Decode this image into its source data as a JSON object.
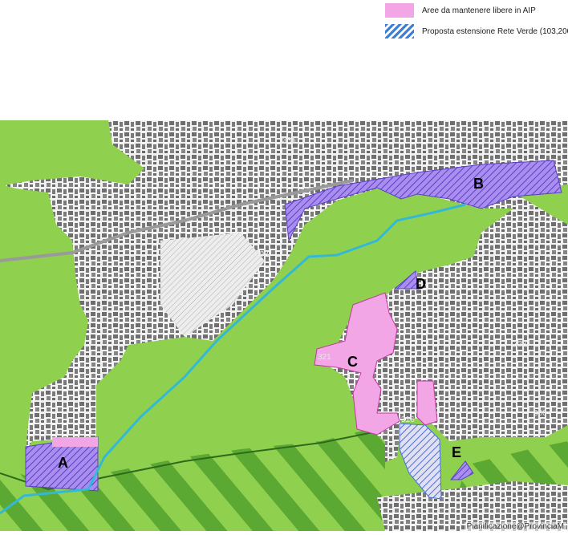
{
  "legend": {
    "items": [
      {
        "label": "Aree da mantenere libere in AIP",
        "swatch": "pink-fill"
      },
      {
        "label": "Proposta estensione Rete Verde (103,200",
        "swatch": "blue-hatch"
      }
    ]
  },
  "map": {
    "labels": [
      "A",
      "B",
      "C",
      "D",
      "E"
    ],
    "elevations": [
      "336",
      "303",
      "321",
      "328",
      "300",
      "316"
    ],
    "credit": "Pianificazione@ProvinciaM"
  },
  "colors": {
    "green": "#8fd14f",
    "dark_green": "#5ba832",
    "pink": "#f2a6e6",
    "purple": "#9a7fe6",
    "river": "#33b8d6",
    "urban": "#6e6e6e"
  }
}
